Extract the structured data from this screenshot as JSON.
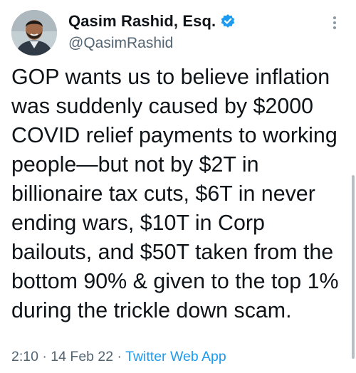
{
  "tweet": {
    "display_name": "Qasim Rashid, Esq.",
    "handle": "@QasimRashid",
    "verified": true,
    "text": "GOP wants us to believe inflation was suddenly caused by $2000 COVID relief payments to working people—but not by $2T in billionaire tax cuts, $6T in never ending wars, $10T in Corp bailouts, and $50T taken from the bottom 90% & given to the top 1% during the trickle down scam.",
    "time": "2:10",
    "separator": "·",
    "date": "14 Feb 22",
    "source": "Twitter Web App"
  },
  "icons": {
    "verified": "verified-badge-icon",
    "more": "more-options-icon"
  },
  "colors": {
    "accent": "#1d9bf0",
    "secondary_text": "#536471",
    "primary_text": "#0f1419"
  }
}
